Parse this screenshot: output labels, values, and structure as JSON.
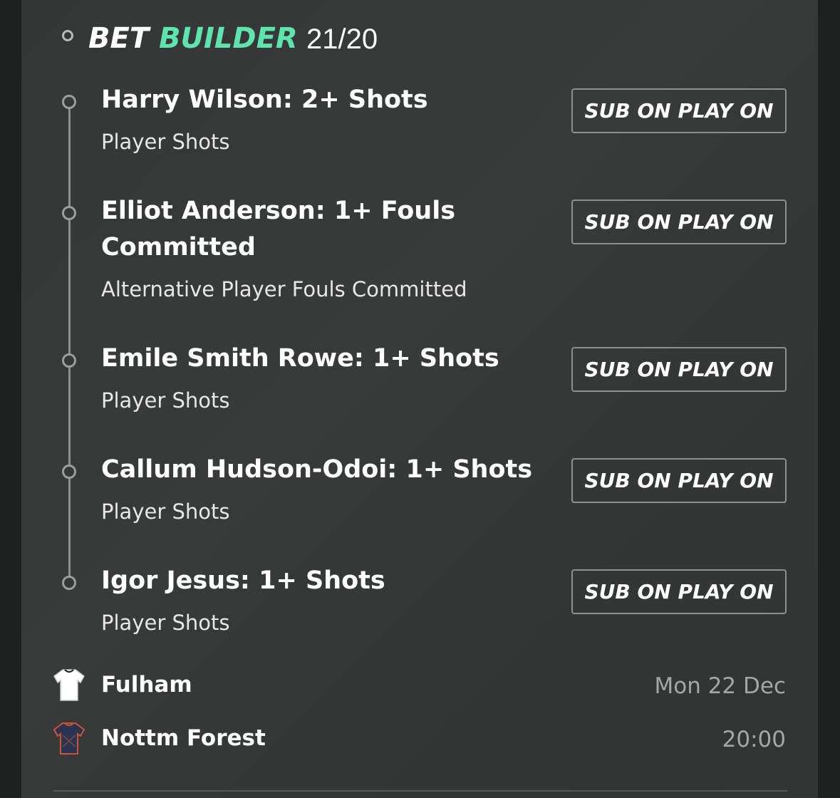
{
  "header": {
    "bet_label": "BET",
    "builder_label": "BUILDER",
    "odds": "21/20"
  },
  "selections": [
    {
      "title": "Harry Wilson: 2+ Shots",
      "market": "Player Shots",
      "button": "SUB ON PLAY ON"
    },
    {
      "title": "Elliot Anderson: 1+ Fouls Committed",
      "market": "Alternative Player Fouls Committed",
      "button": "SUB ON PLAY ON"
    },
    {
      "title": "Emile Smith Rowe: 1+ Shots",
      "market": "Player Shots",
      "button": "SUB ON PLAY ON"
    },
    {
      "title": "Callum Hudson-Odoi: 1+ Shots",
      "market": "Player Shots",
      "button": "SUB ON PLAY ON"
    },
    {
      "title": "Igor Jesus: 1+ Shots",
      "market": "Player Shots",
      "button": "SUB ON PLAY ON"
    }
  ],
  "match": {
    "home_team": "Fulham",
    "away_team": "Nottm Forest",
    "date": "Mon 22 Dec",
    "time": "20:00",
    "home_shirt_icon": "fulham-shirt-icon",
    "away_shirt_icon": "forest-shirt-icon"
  },
  "colors": {
    "accent": "#5fe3b0",
    "background": "#363938",
    "text": "#ffffff",
    "muted": "#a5a7a6"
  }
}
